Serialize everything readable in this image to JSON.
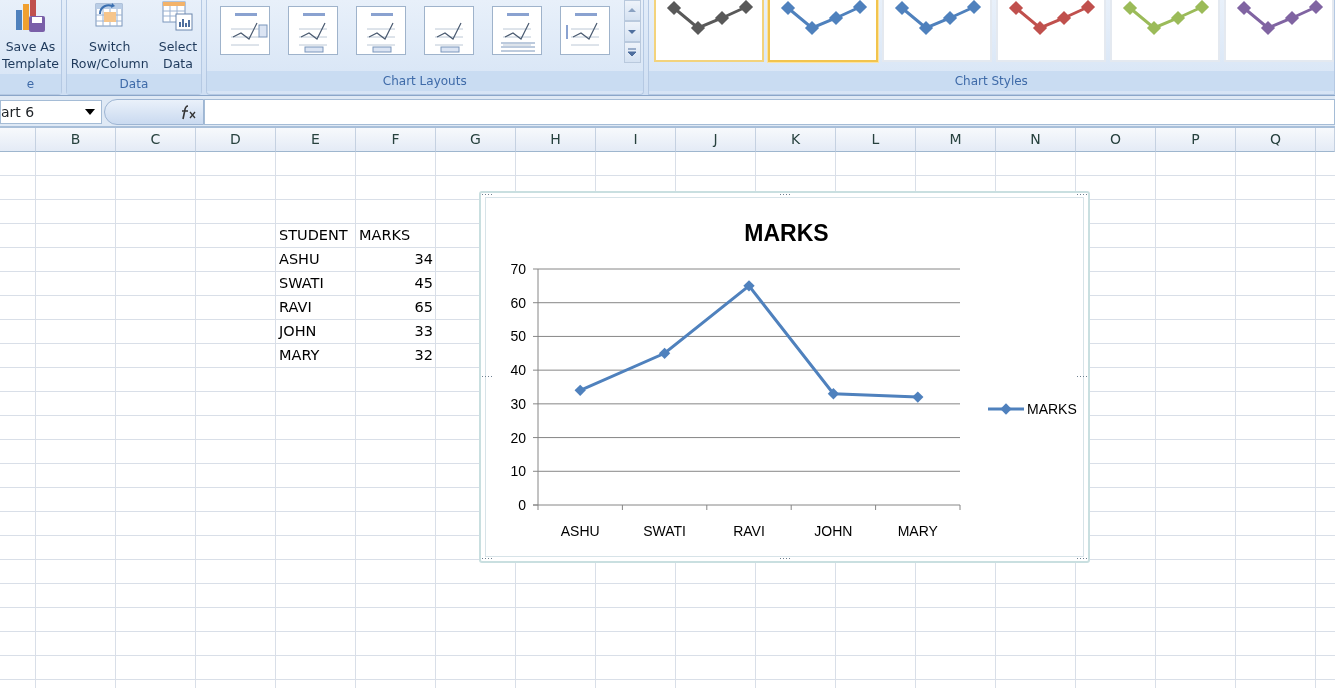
{
  "ribbon": {
    "groups": [
      {
        "label": "e",
        "buttons": [
          {
            "kind": "save-template",
            "lines": [
              "Save As",
              "Template"
            ]
          }
        ]
      },
      {
        "label": "Data",
        "buttons": [
          {
            "kind": "switch",
            "lines": [
              "Switch",
              "Row/Column"
            ]
          },
          {
            "kind": "select",
            "lines": [
              "Select",
              "Data"
            ]
          }
        ]
      },
      {
        "label": "Chart Layouts",
        "kind": "layouts"
      },
      {
        "label": "Chart Styles",
        "kind": "styles"
      }
    ]
  },
  "chart_layouts": [
    {
      "kind": "legend-right"
    },
    {
      "kind": "data-labels"
    },
    {
      "kind": "legend-bottom"
    },
    {
      "kind": "no-title"
    },
    {
      "kind": "data-table"
    },
    {
      "kind": "axis-title"
    }
  ],
  "chart_styles": [
    {
      "color": "#595959",
      "hovered": true,
      "selected": false
    },
    {
      "color": "#4f81bd",
      "hovered": false,
      "selected": true
    },
    {
      "color": "#4f81bd",
      "hovered": false,
      "selected": false
    },
    {
      "color": "#c0504d",
      "hovered": false,
      "selected": false
    },
    {
      "color": "#9bbb59",
      "hovered": false,
      "selected": false
    },
    {
      "color": "#8064a2",
      "hovered": false,
      "selected": false
    }
  ],
  "name_box": "art 6",
  "columns": [
    "B",
    "C",
    "D",
    "E",
    "F",
    "G",
    "H",
    "I",
    "J",
    "K",
    "L",
    "M",
    "N",
    "O",
    "P",
    "Q"
  ],
  "table": {
    "columns": [
      "STUDENT",
      "MARKS"
    ],
    "rows": [
      [
        "ASHU",
        "34"
      ],
      [
        "SWATI",
        "45"
      ],
      [
        "RAVI",
        "65"
      ],
      [
        "JOHN",
        "33"
      ],
      [
        "MARY",
        "32"
      ]
    ]
  },
  "chart": {
    "chart_data": {
      "type": "line",
      "title": "MARKS",
      "categories": [
        "ASHU",
        "SWATI",
        "RAVI",
        "JOHN",
        "MARY"
      ],
      "series": [
        {
          "name": "MARKS",
          "color": "#4f81bd",
          "marker": "diamond",
          "values": [
            34,
            45,
            65,
            33,
            32
          ]
        }
      ],
      "grid": true,
      "ylim": [
        0,
        70
      ],
      "yticks": [
        0,
        10,
        20,
        30,
        40,
        50,
        60,
        70
      ]
    }
  }
}
